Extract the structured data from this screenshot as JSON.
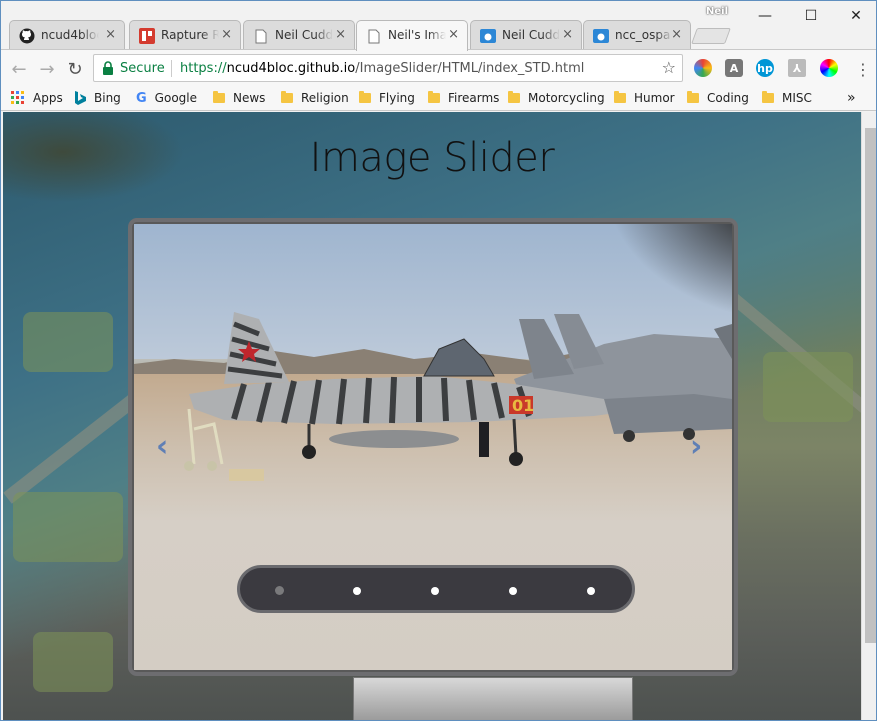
{
  "browser": {
    "profile_name": "Neil",
    "tabs": [
      {
        "title": "ncud4bloc",
        "favicon": "github-icon"
      },
      {
        "title": "Rapture R",
        "favicon": "rapture-icon"
      },
      {
        "title": "Neil Cudd",
        "favicon": "page-icon"
      },
      {
        "title": "Neil's Ima",
        "favicon": "page-icon",
        "active": true
      },
      {
        "title": "Neil Cudd",
        "favicon": "cloud-icon"
      },
      {
        "title": "ncc_ospa",
        "favicon": "cloud-icon"
      }
    ],
    "close_glyph": "×",
    "window_controls": {
      "minimize": "—",
      "maximize": "☐",
      "close": "✕"
    },
    "nav": {
      "back": "←",
      "forward": "→",
      "reload": "↻"
    },
    "omnibox": {
      "secure_label": "Secure",
      "url_scheme": "https://",
      "url_domain": "ncud4bloc.github.io",
      "url_path": "/ImageSlider/HTML/index_STD.html"
    },
    "bookmarks": {
      "apps_label": "Apps",
      "items": [
        "Bing",
        "Google",
        "News",
        "Religion",
        "Flying",
        "Firearms",
        "Motorcycling",
        "Humor",
        "Coding",
        "MISC"
      ],
      "overflow": "»"
    },
    "menu_glyph": "⋮",
    "star_glyph": "☆"
  },
  "page": {
    "title": "Image Slider",
    "prev_arrow": "‹",
    "next_arrow": "›",
    "slide_count": 5,
    "active_slide": 1,
    "slide_description_image": "fighter-jets-on-tarmac",
    "accent_color": "#5f7fb5"
  }
}
